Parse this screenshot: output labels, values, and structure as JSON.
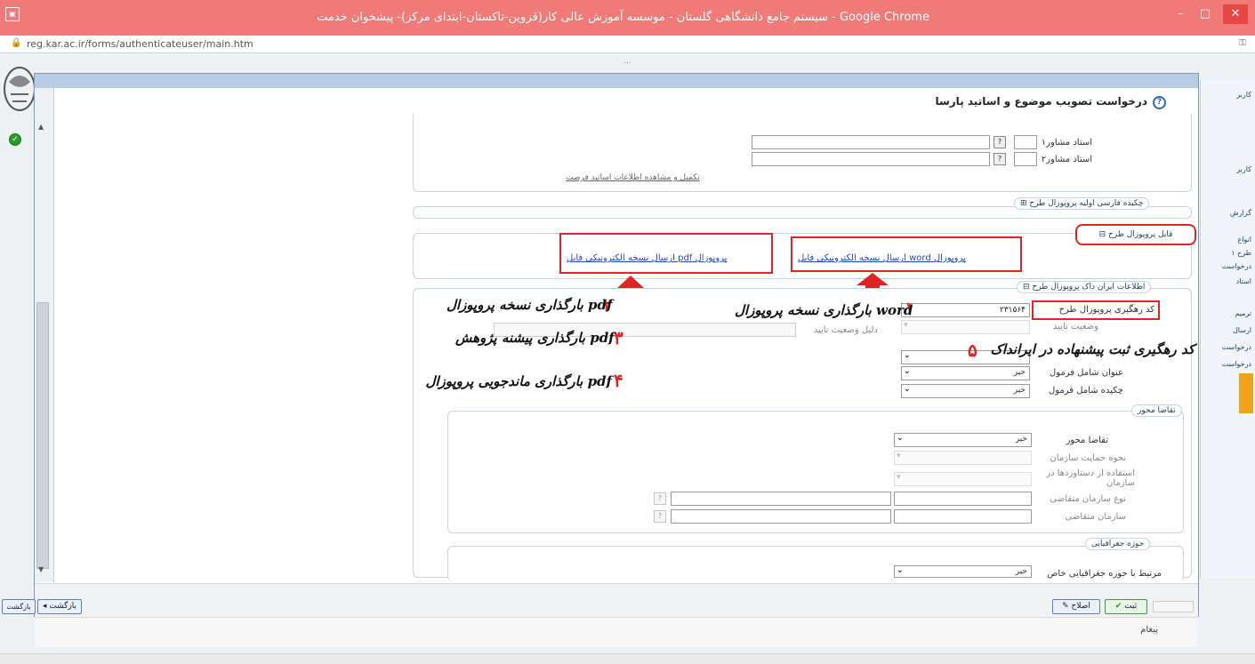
{
  "window": {
    "title": "سیستم جامع دانشگاهی گلستان - موسسه آموزش عالی کار(قزوین-تاکستان-ابتدای مرکز)- پیشخوان خدمت - Google Chrome",
    "minimize": "–",
    "maximize": "□",
    "close": "✕"
  },
  "browser": {
    "url": "reg.kar.ac.ir/forms/authenticateuser/main.htm",
    "tab_header": "..."
  },
  "dialog": {
    "title": "درخواست تصویب موضوع و اساتید پارسا",
    "advisor_1_label": "استاد مشاور۱",
    "advisor_2_label": "استاد مشاور۲",
    "advisor_1_value": "",
    "advisor_2_value": "",
    "advisor_1_code": "",
    "advisor_2_code": "",
    "complete_info_link": "تکمیل و مشاهده اطلاعات اساتید فرصت",
    "persian_abstract_legend": "چکیده فارسی اولیه پروپوزال طرح",
    "proposal_files_legend": "فایل پروپوزال طرح",
    "send_word_link": "ارسال نسخه الکترونیکی فایل word پروپوزال",
    "send_pdf_link": "ارسال نسخه الکترونیکی فایل pdf پروپوزال",
    "proposal_info_legend": "اطلاعات ایران داک پروپوزال طرح",
    "tracking_code_label": "کد رهگیری پروپوزال طرح",
    "tracking_code_value": "۲۳۱۵۶۴",
    "approval_status_label": "وضعیت تایید",
    "approval_reason_label": "دلیل وضعیت تایید",
    "title_included_label": "عنوان شامل فرمول",
    "title_included_value": "خیر",
    "abstract_included_label": "چکیده شامل فرمول",
    "abstract_included_value": "خیر",
    "applied_legend": "تقاضا محور",
    "applied_label": "تقاضا محور",
    "applied_value": "خیر",
    "support_label": "نحوه حمایت سازمان",
    "use_label": "استفاده از دستاوردها در سازمان",
    "org_type_label": "نوع سازمان متقاضی",
    "org_label": "سازمان متقاضی",
    "geo_legend": "حوزه جغرافیایی",
    "geo_label": "مرتبط با حوزه جغرافیایی خاص",
    "geo_value": "خیر"
  },
  "annotations": {
    "n1": "۱",
    "n2": "۲",
    "n3": "۳",
    "n4": "۴",
    "n5": "۵",
    "note1": "بارگذاری نسخه پروپوزال word",
    "note2": "بارگذاری نسخه پروپوزال pdf",
    "note3": "بارگذاری پیشنه پژوهش pdf",
    "note4": "بارگذاری ماندجویی پروپوزال pdf",
    "note5": "کد رهگیری ثبت پیشنهاده در ایرانداک"
  },
  "footer": {
    "back_button": "بازگشت",
    "back_button_left": "بازگشت",
    "confirm_button": "ثبت",
    "edit_button": "اصلاح",
    "message_label": "پیغام"
  },
  "right_panel": {
    "items": [
      "کاربر",
      "کاربر",
      "گزارش",
      "انواع",
      "طرح ۱",
      "درخواست",
      "استاد",
      "ترمیم",
      "ارسال",
      "درخواست",
      "درخواست"
    ]
  },
  "colors": {
    "titlebar": "#f07a78",
    "annotation_red": "#e02424",
    "link_blue": "#1a4fb0"
  }
}
